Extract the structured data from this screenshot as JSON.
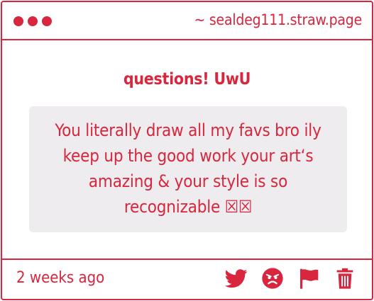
{
  "window": {
    "site": "~ sealdeg111.straw.page"
  },
  "question": {
    "heading": "questions! UwU",
    "message_lines": [
      "You literally draw all my favs bro ily",
      "keep up the good work your art‘s",
      "amazing & your style is so",
      "recognizable ☒☒"
    ]
  },
  "footer": {
    "timestamp": "2 weeks ago",
    "actions": [
      {
        "icon": "twitter-icon"
      },
      {
        "icon": "angry-face-icon"
      },
      {
        "icon": "flag-icon"
      },
      {
        "icon": "trash-icon"
      }
    ]
  },
  "colors": {
    "accent": "#d7263d",
    "message_bg": "#eeecee"
  }
}
